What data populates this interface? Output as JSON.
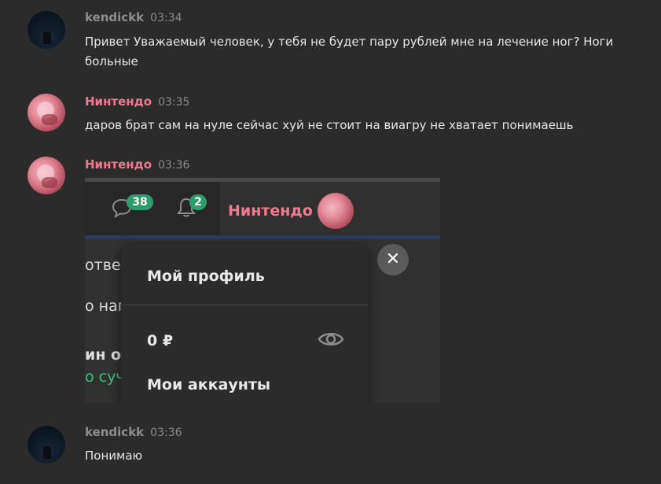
{
  "messages": [
    {
      "author": "kendickk",
      "time": "03:34",
      "text": "Привет Уважаемый человек, у тебя не будет пару рублей мне на лечение ног? Ноги больные"
    },
    {
      "author": "Нинтендо",
      "time": "03:35",
      "text": "даров брат сам на нуле сейчас хуй не стоит на виагру не хватает понимаешь"
    },
    {
      "author": "Нинтендо",
      "time": "03:36",
      "text": ""
    },
    {
      "author": "kendickk",
      "time": "03:36",
      "text": "Понимаю"
    }
  ],
  "screenshot": {
    "chat_badge": "38",
    "notif_badge": "2",
    "username": "Нинтендо",
    "bg_lines": [
      "ответ",
      "о нап",
      "ин о",
      "о суч"
    ],
    "menu": {
      "profile": "Мой профиль",
      "balance": "0 ₽",
      "accounts": "Мои аккаунты"
    },
    "close_symbol": "✕"
  },
  "colors": {
    "background": "#2b2b2b",
    "name_k": "#8d8d8d",
    "name_n": "#f07a8e",
    "badge": "#2f9c6b"
  }
}
